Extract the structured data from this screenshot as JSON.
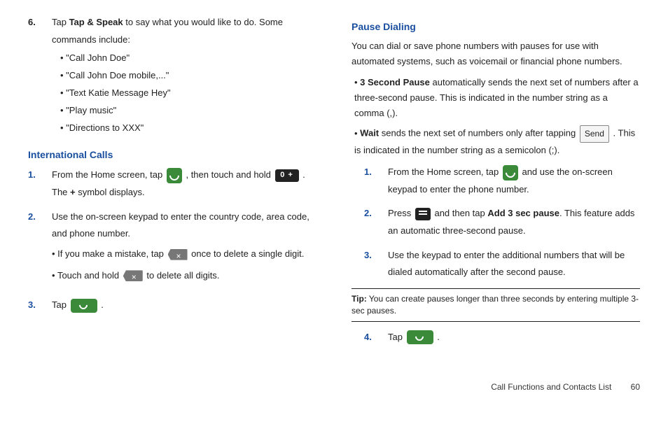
{
  "left": {
    "step6": {
      "num": "6.",
      "text_pre": "Tap ",
      "bold": "Tap & Speak",
      "text_post": " to say what you would like to do. Some commands include:",
      "commands": [
        "\"Call John Doe\"",
        "\"Call John Doe mobile,...\"",
        "\"Text Katie Message Hey\"",
        "\"Play music\"",
        "\"Directions to XXX\""
      ]
    },
    "intl_heading": "International Calls",
    "intl_steps": {
      "s1": {
        "num": "1.",
        "pre": "From the Home screen, tap ",
        "mid": " , then touch and hold ",
        "post1": " . The ",
        "plus": "+",
        "post2": " symbol displays."
      },
      "s2": {
        "num": "2.",
        "text": "Use the on-screen keypad to enter the country code, area code, and phone number."
      },
      "s2_sub": {
        "a_pre": "If you make a mistake, tap ",
        "a_post": " once to delete a single digit.",
        "b_pre": "Touch and hold ",
        "b_post": " to delete all digits."
      },
      "s3": {
        "num": "3.",
        "pre": "Tap ",
        "post": " ."
      }
    }
  },
  "right": {
    "pause_heading": "Pause Dialing",
    "intro": "You can dial or save phone numbers with pauses for use with automated systems, such as voicemail or financial phone numbers.",
    "b1": {
      "bold": "3 Second Pause",
      "text": " automatically sends the next set of numbers after a three-second pause. This is indicated in the number string as a comma (,)."
    },
    "b2": {
      "bold": "Wait",
      "pre": " sends the next set of numbers only after tapping ",
      "send": "Send",
      "post": " . This is indicated in the number string as a semicolon (;)."
    },
    "steps": {
      "s1": {
        "num": "1.",
        "pre": "From the Home screen, tap ",
        "post": " and use the on-screen keypad to enter the phone number."
      },
      "s2": {
        "num": "2.",
        "pre": "Press ",
        "mid": " and then tap ",
        "bold": "Add 3 sec pause",
        "post": ". This feature adds an automatic three-second pause."
      },
      "s3": {
        "num": "3.",
        "text": "Use the keypad to enter the additional numbers that will be dialed automatically after the second pause."
      }
    },
    "tip_label": "Tip:",
    "tip_text": " You can create pauses longer than three seconds by entering multiple 3-sec pauses.",
    "s4": {
      "num": "4.",
      "pre": "Tap ",
      "post": " ."
    }
  },
  "footer": {
    "text": "Call Functions and Contacts List",
    "page": "60"
  },
  "icons": {
    "zero": "0  +"
  }
}
